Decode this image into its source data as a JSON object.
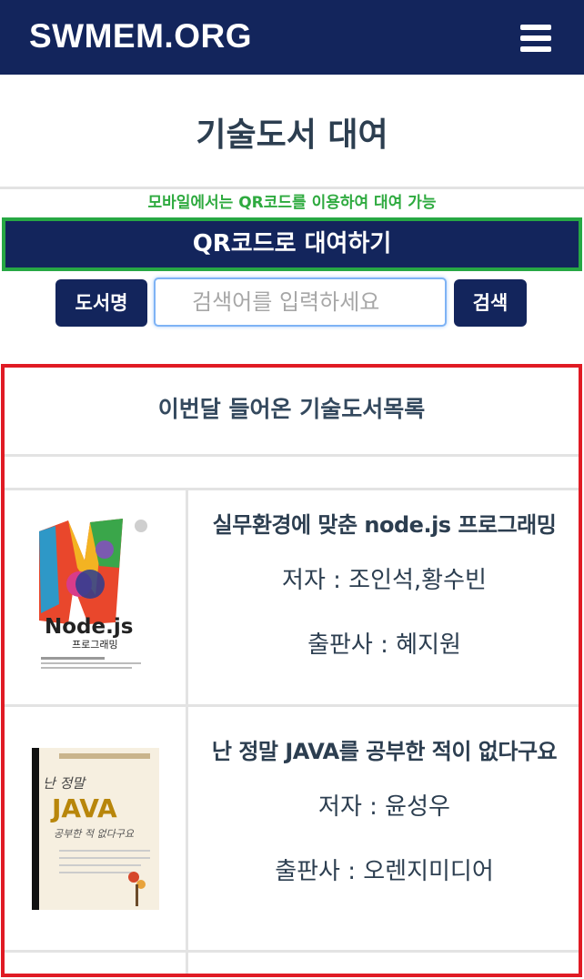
{
  "header": {
    "brand": "SWMEM.ORG",
    "menu_icon": "hamburger-icon"
  },
  "page": {
    "title": "기술도서 대여",
    "mobile_note": "모바일에서는 QR코드를 이용하여 대여 가능",
    "qr_button": "QR코드로 대여하기"
  },
  "search": {
    "type_label": "도서명",
    "placeholder": "검색어를 입력하세요",
    "value": "",
    "button_label": "검색"
  },
  "books_section": {
    "heading": "이번달 들어온 기술도서목록",
    "books": [
      {
        "title": "실무환경에 맞춘 node.js 프로그래밍",
        "author": "저자 : 조인석,황수빈",
        "publisher": "출판사 : 혜지원",
        "cover_text": "Node.js",
        "cover_subtitle": "프로그래밍"
      },
      {
        "title": "난 정말 JAVA를 공부한 적이 없다구요",
        "author": "저자 : 윤성우",
        "publisher": "출판사 : 오렌지미디어",
        "cover_text": "JAVA",
        "cover_top": "난 정말",
        "cover_bottom": "공부한 적 없다구요"
      }
    ]
  },
  "colors": {
    "navy": "#13255c",
    "green_note": "#2eaa3f",
    "qr_border": "#27a844",
    "panel_border": "#e01b24",
    "text": "#2c3e50"
  }
}
